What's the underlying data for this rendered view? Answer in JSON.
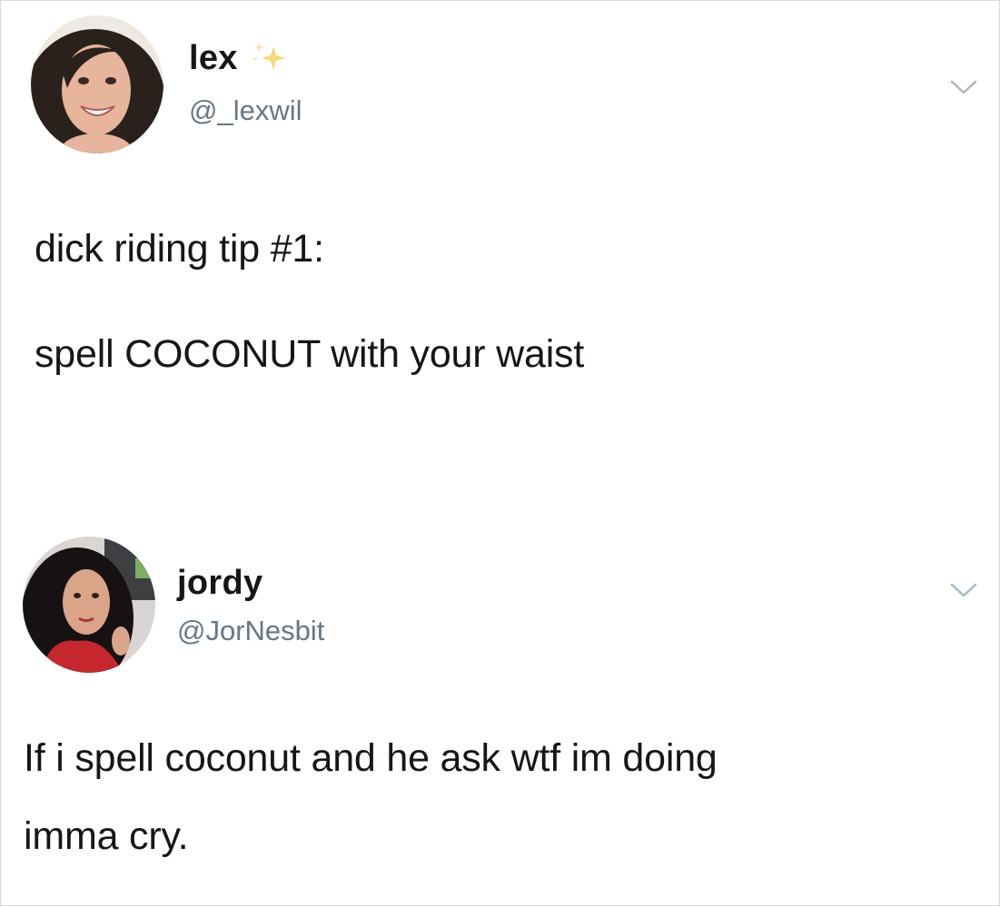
{
  "tweets": [
    {
      "display_name": "lex",
      "handle": "@_lexwil",
      "lines": [
        "dick riding tip #1:",
        "spell COCONUT with your waist"
      ],
      "avatar_icon": "profile-photo",
      "badge_icon": "sparkle-icon",
      "badge_color": "#f5d469"
    },
    {
      "display_name": "jordy",
      "handle": "@JorNesbit",
      "lines": [
        "If i spell coconut and he ask wtf im doing",
        "imma cry."
      ],
      "avatar_icon": "profile-photo"
    }
  ],
  "colors": {
    "text": "#14171a",
    "secondary_text": "#657786",
    "chevron": "#aab8c2",
    "background": "#ffffff"
  }
}
